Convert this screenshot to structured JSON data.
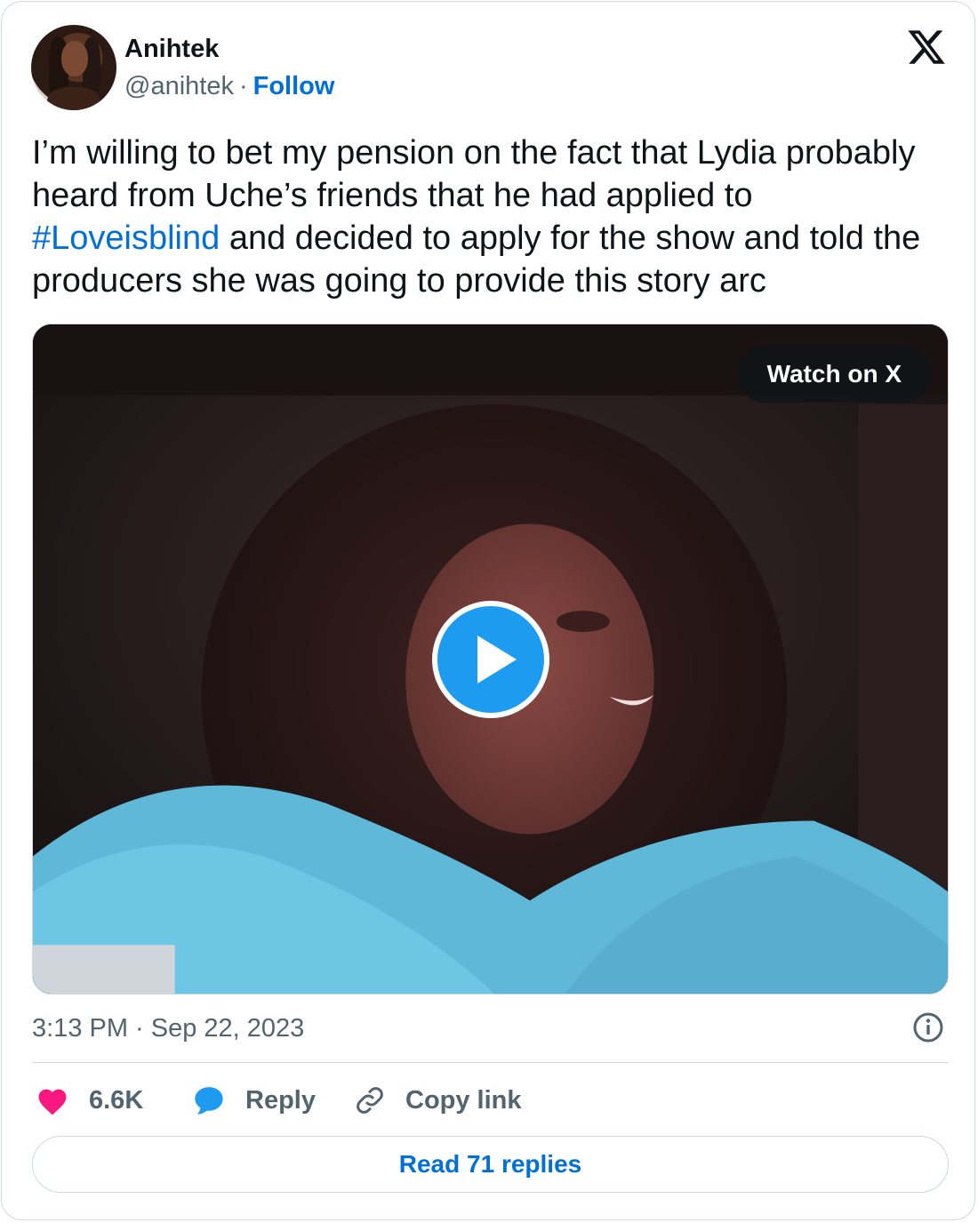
{
  "author": {
    "name": "Anihtek",
    "handle": "@anihtek",
    "separator": "·",
    "follow_label": "Follow"
  },
  "tweet": {
    "text_before": "I’m willing to bet my pension on the fact that Lydia probably heard from Uche’s friends that he had applied to ",
    "hashtag": "#Loveisblind",
    "text_after": " and decided to apply for the show and told the producers she was going to provide this story arc"
  },
  "media": {
    "type": "video",
    "watch_label": "Watch on X",
    "play_icon": "play-icon"
  },
  "meta": {
    "timestamp": "3:13 PM · Sep 22, 2023",
    "info_icon": "info-icon"
  },
  "actions": {
    "like_count": "6.6K",
    "reply_label": "Reply",
    "copy_link_label": "Copy link"
  },
  "read_replies_label": "Read 71 replies",
  "colors": {
    "link": "#006fd6",
    "like_heart": "#f91880",
    "reply_bubble": "#1d9bf0",
    "secondary_text": "#536471",
    "border": "#cfd9de"
  }
}
